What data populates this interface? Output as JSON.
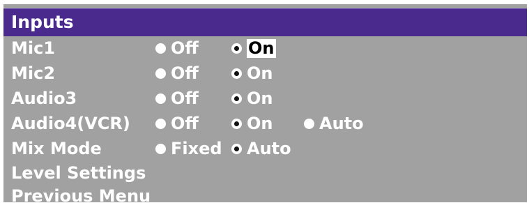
{
  "menu": {
    "title": "Inputs",
    "rows": [
      {
        "label": "Mic1",
        "options": [
          {
            "text": "Off",
            "selected": false,
            "focused": false
          },
          {
            "text": "On",
            "selected": true,
            "focused": true
          }
        ]
      },
      {
        "label": "Mic2",
        "options": [
          {
            "text": "Off",
            "selected": false,
            "focused": false
          },
          {
            "text": "On",
            "selected": true,
            "focused": false
          }
        ]
      },
      {
        "label": "Audio3",
        "options": [
          {
            "text": "Off",
            "selected": false,
            "focused": false
          },
          {
            "text": "On",
            "selected": true,
            "focused": false
          }
        ]
      },
      {
        "label": "Audio4(VCR)",
        "options": [
          {
            "text": "Off",
            "selected": false,
            "focused": false
          },
          {
            "text": "On",
            "selected": true,
            "focused": false
          },
          {
            "text": "Auto",
            "selected": false,
            "focused": false
          }
        ]
      },
      {
        "label": "Mix Mode",
        "options": [
          {
            "text": "Fixed",
            "selected": false,
            "focused": false
          },
          {
            "text": "Auto",
            "selected": true,
            "focused": false
          }
        ]
      },
      {
        "label": "Level Settings"
      },
      {
        "label": "Previous Menu"
      }
    ]
  },
  "colors": {
    "title_bar": "#4b2a8e",
    "panel": "#a1a1a1",
    "text": "#ffffff"
  }
}
